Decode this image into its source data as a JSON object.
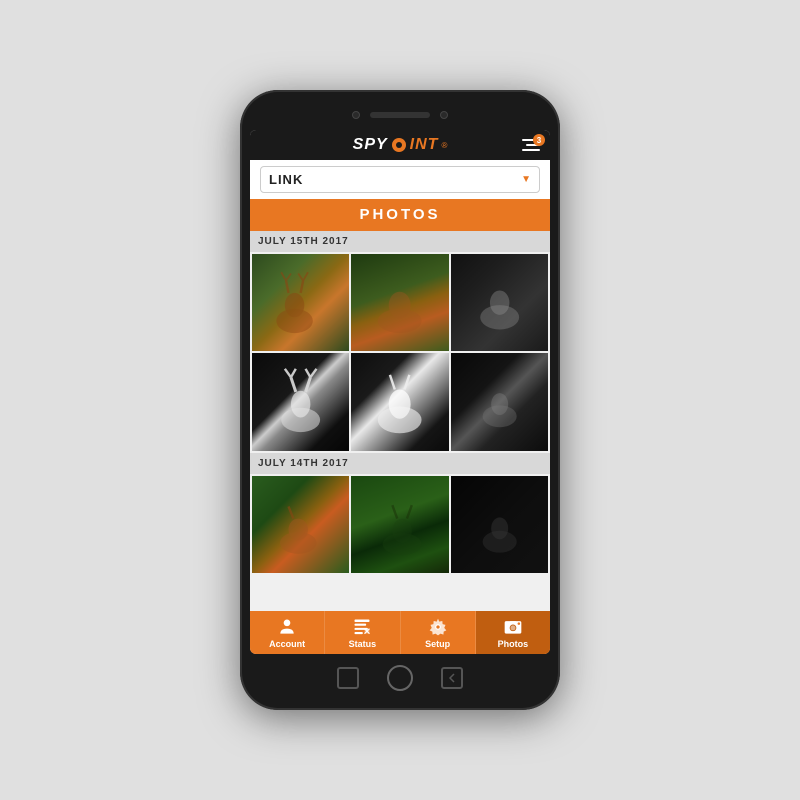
{
  "phone": {
    "logo": {
      "spy": "SPY",
      "point": "P",
      "rest": "INT",
      "trademark": "®"
    },
    "menu_badge": "3"
  },
  "header": {
    "camera_name": "LINK",
    "dropdown_arrow": "▼"
  },
  "photos_section": {
    "title": "PHOTOS"
  },
  "date_groups": [
    {
      "date": "JULY 15TH 2017",
      "photos": [
        "color-deer-1",
        "color-deer-2",
        "night-trees",
        "night-deer-1",
        "night-deer-2",
        "night-trees-2"
      ]
    },
    {
      "date": "JULY 14TH 2017",
      "photos": [
        "color-deer-3",
        "color-deer-4",
        "dark-night"
      ]
    }
  ],
  "bottom_nav": {
    "items": [
      {
        "id": "account",
        "label": "Account",
        "active": false
      },
      {
        "id": "status",
        "label": "Status",
        "active": false
      },
      {
        "id": "setup",
        "label": "Setup",
        "active": false
      },
      {
        "id": "photos",
        "label": "Photos",
        "active": true
      }
    ]
  }
}
